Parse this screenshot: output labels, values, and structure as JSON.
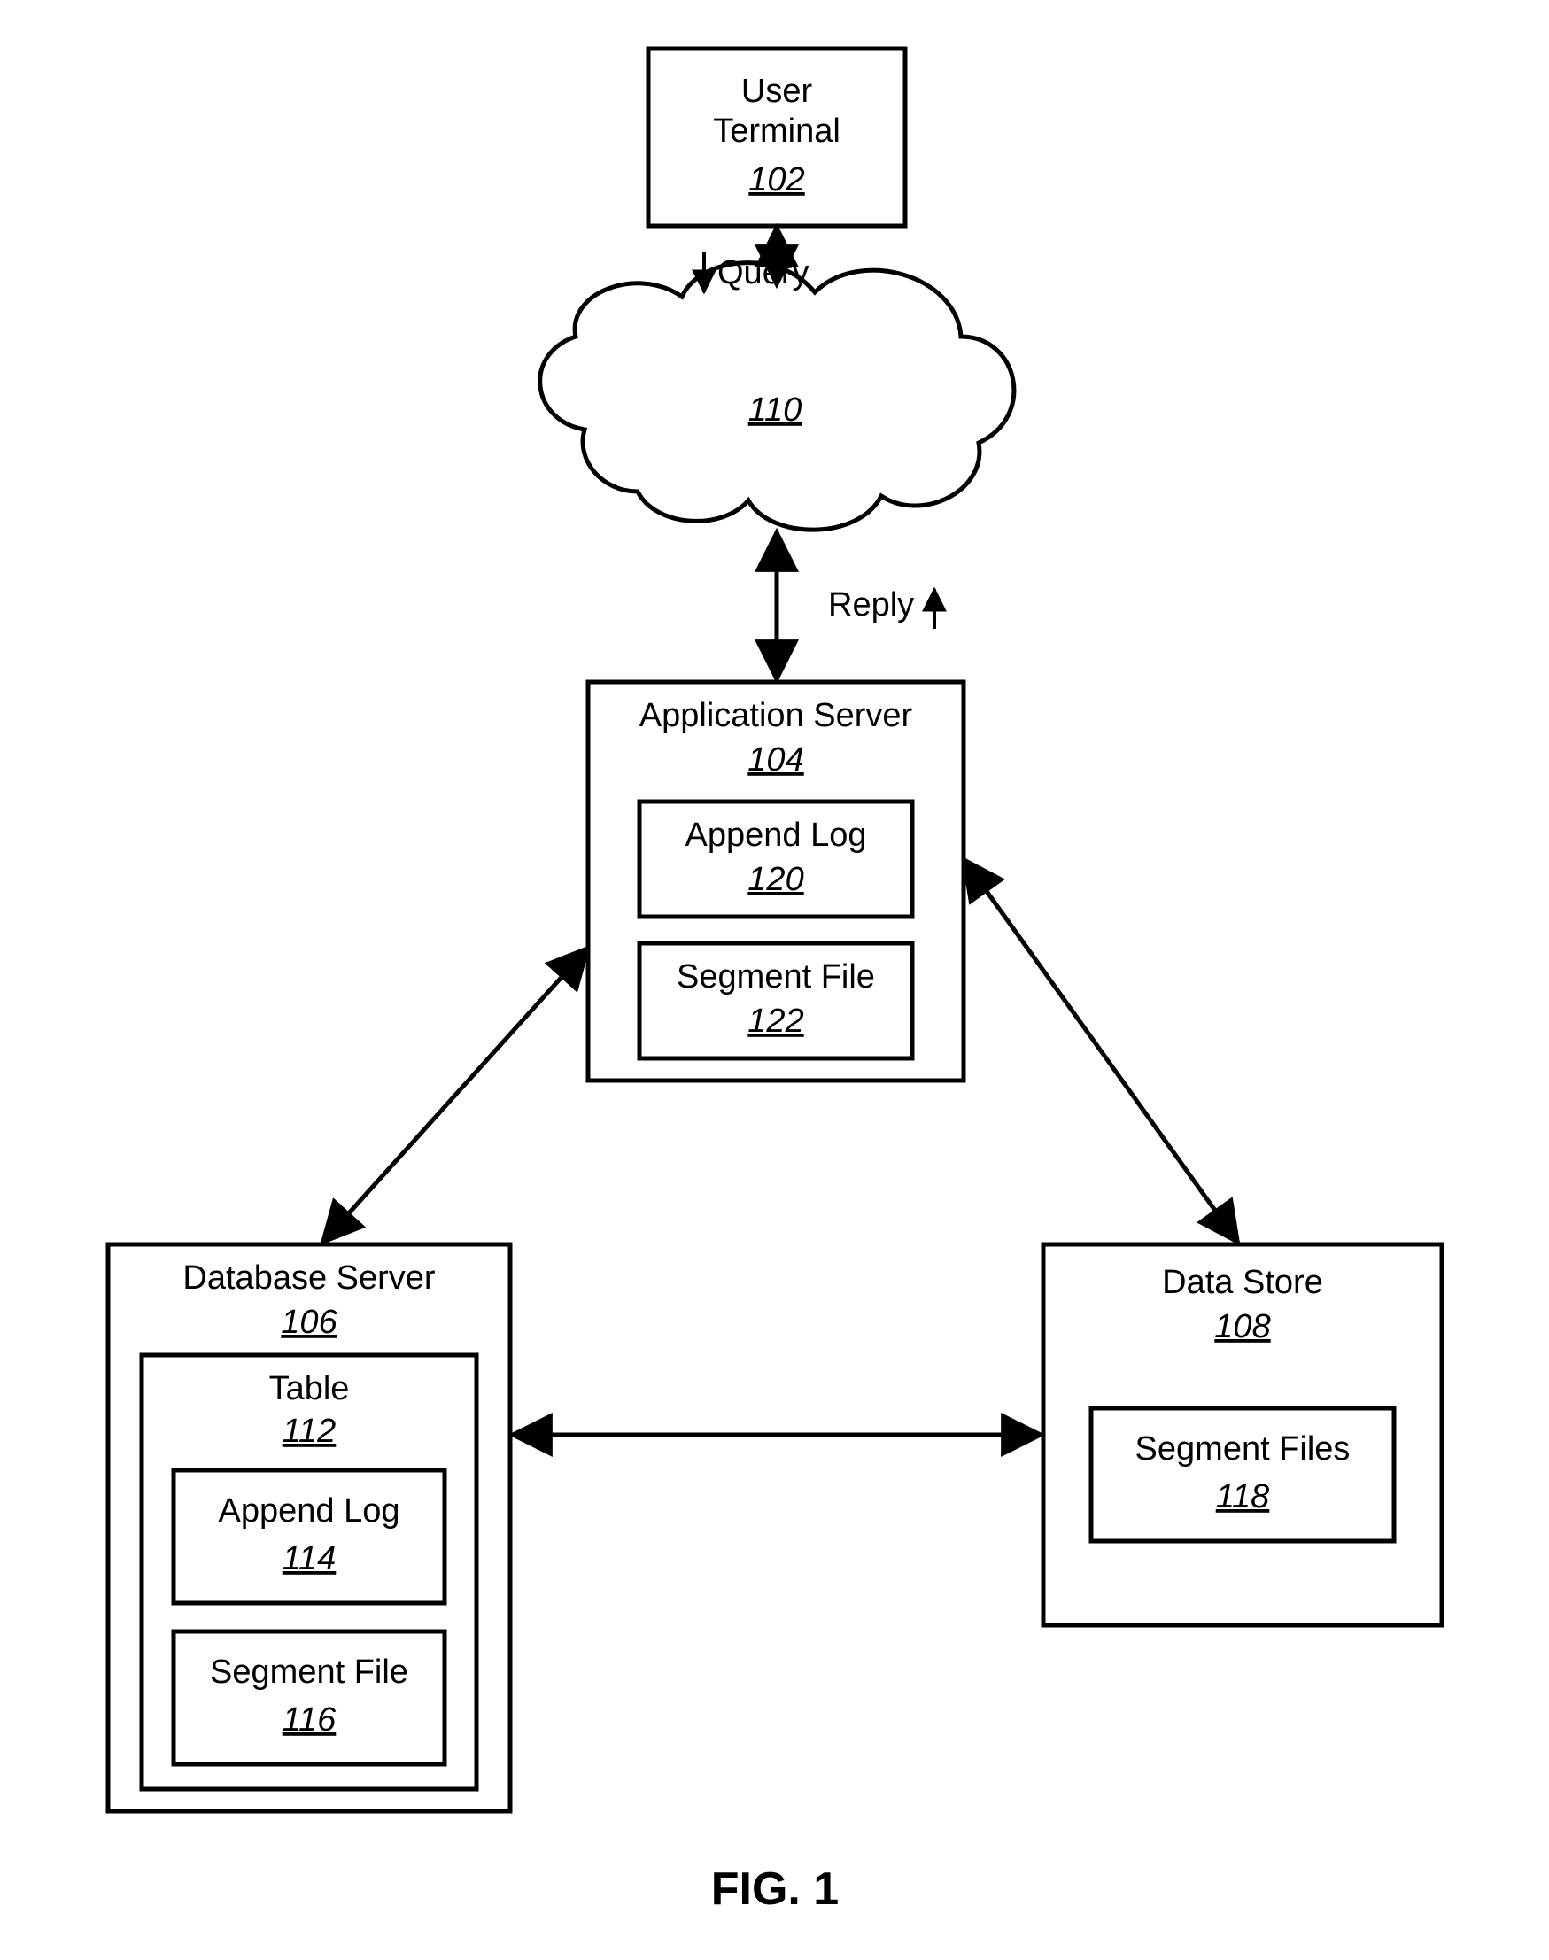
{
  "nodes": {
    "user_terminal": {
      "line1": "User",
      "line2": "Terminal",
      "ref": "102"
    },
    "cloud": {
      "ref": "110"
    },
    "app_server": {
      "title": "Application Server",
      "ref": "104",
      "inner1": {
        "title": "Append Log",
        "ref": "120"
      },
      "inner2": {
        "title": "Segment File",
        "ref": "122"
      }
    },
    "db_server": {
      "title": "Database Server",
      "ref": "106",
      "table": {
        "title": "Table",
        "ref": "112",
        "inner1": {
          "title": "Append Log",
          "ref": "114"
        },
        "inner2": {
          "title": "Segment File",
          "ref": "116"
        }
      }
    },
    "data_store": {
      "title": "Data Store",
      "ref": "108",
      "inner1": {
        "title": "Segment Files",
        "ref": "118"
      }
    }
  },
  "edges": {
    "query": "Query",
    "reply": "Reply"
  },
  "figure": "FIG. 1"
}
